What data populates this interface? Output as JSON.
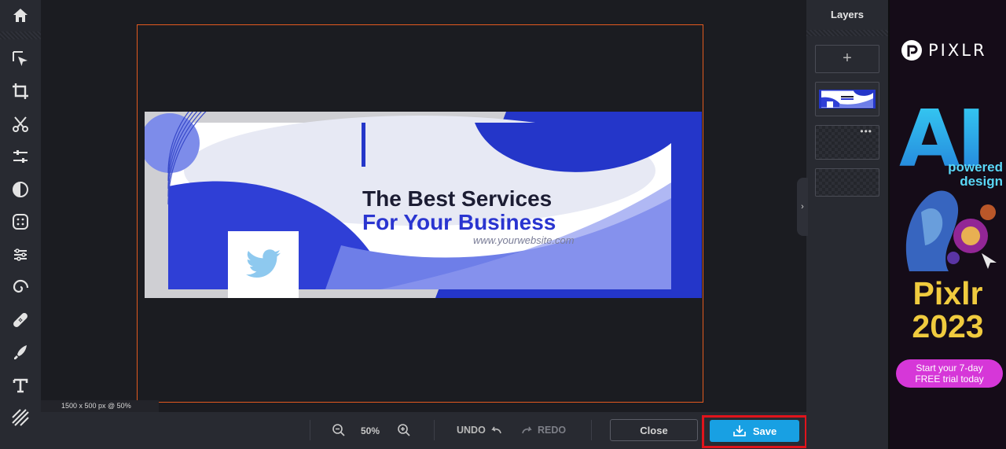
{
  "editor": {
    "toolbar": {
      "tools": [
        "home-icon",
        "arrange-icon",
        "crop-icon",
        "cutout-icon",
        "adjust-icon",
        "filter-icon",
        "effect-icon",
        "liquify-icon",
        "retouch-icon",
        "heal-icon",
        "draw-icon",
        "text-icon",
        "pattern-icon"
      ]
    },
    "canvas": {
      "size_readout": "1500 x 500 px @ 50%",
      "banner": {
        "title_line1": "The Best Services",
        "title_line2": "For Your Business",
        "website": "www.yourwebsite.com",
        "icon": "twitter-icon"
      }
    },
    "bottombar": {
      "zoom": "50%",
      "undo_label": "UNDO",
      "redo_label": "REDO",
      "close_label": "Close",
      "save_label": "Save"
    },
    "layers": {
      "title": "Layers",
      "add_symbol": "+",
      "more_symbol": "•••",
      "collapse_symbol": "›"
    }
  },
  "ad": {
    "logo": "PIXLR",
    "headline": "AI",
    "tagline_1": "powered",
    "tagline_2": "design",
    "product_1": "Pixlr",
    "product_2": "2023",
    "cta_1": "Start your 7-day",
    "cta_2": "FREE trial today"
  },
  "colors": {
    "accent": "#18a0e3",
    "crop_frame": "#e35a1f",
    "highlight": "#e0141c",
    "banner_blue": "#2a35d0"
  }
}
